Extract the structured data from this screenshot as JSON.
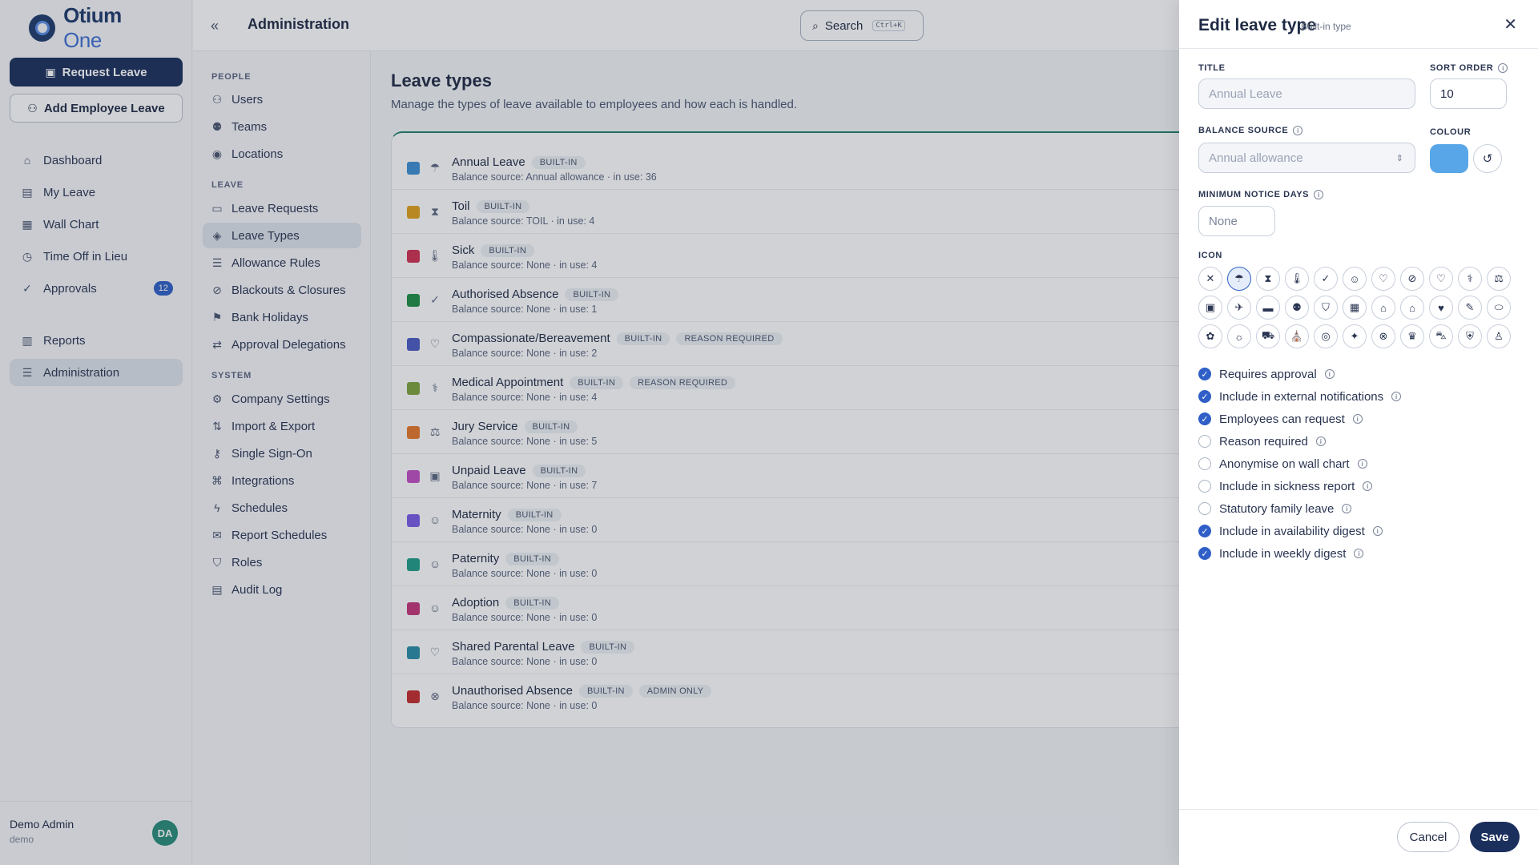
{
  "app": {
    "logo_main": "Otium",
    "logo_accent": "One"
  },
  "sidebar": {
    "request_leave": "Request Leave",
    "add_employee_leave": "Add Employee Leave",
    "items": [
      {
        "label": "Dashboard",
        "icon": "home-icon"
      },
      {
        "label": "My Leave",
        "icon": "calendar-icon"
      },
      {
        "label": "Wall Chart",
        "icon": "calendar-grid-icon"
      },
      {
        "label": "Time Off in Lieu",
        "icon": "clock-icon"
      },
      {
        "label": "Approvals",
        "icon": "check-circle-icon",
        "badge": "12"
      },
      {
        "label": "Reports",
        "icon": "report-icon"
      },
      {
        "label": "Administration",
        "icon": "sliders-icon",
        "active": true
      }
    ],
    "user": {
      "name": "Demo Admin",
      "role": "demo",
      "initials": "DA"
    }
  },
  "topbar": {
    "title": "Administration",
    "search_label": "Search",
    "search_shortcut": "Ctrl+K"
  },
  "admin_nav": {
    "people_label": "PEOPLE",
    "people": [
      "Users",
      "Teams",
      "Locations"
    ],
    "leave_label": "LEAVE",
    "leave": [
      "Leave Requests",
      "Leave Types",
      "Allowance Rules",
      "Blackouts & Closures",
      "Bank Holidays",
      "Approval Delegations"
    ],
    "system_label": "SYSTEM",
    "system": [
      "Company Settings",
      "Import & Export",
      "Single Sign-On",
      "Integrations",
      "Schedules",
      "Report Schedules",
      "Roles",
      "Audit Log"
    ]
  },
  "main": {
    "title": "Leave types",
    "subtitle": "Manage the types of leave available to employees and how each is handled.",
    "rows": [
      {
        "title": "Annual Leave",
        "badges": [
          "BUILT-IN"
        ],
        "sub": "Balance source: Annual allowance · in use: 36",
        "color": "#3d8fd4"
      },
      {
        "title": "Toil",
        "badges": [
          "BUILT-IN"
        ],
        "sub": "Balance source: TOIL · in use: 4",
        "color": "#e0a21a"
      },
      {
        "title": "Sick",
        "badges": [
          "BUILT-IN"
        ],
        "sub": "Balance source: None · in use: 4",
        "color": "#d12f52"
      },
      {
        "title": "Authorised Absence",
        "badges": [
          "BUILT-IN"
        ],
        "sub": "Balance source: None · in use: 1",
        "color": "#1f8f45"
      },
      {
        "title": "Compassionate/Bereavement",
        "badges": [
          "BUILT-IN",
          "REASON REQUIRED"
        ],
        "sub": "Balance source: None · in use: 2",
        "color": "#4b5bc4"
      },
      {
        "title": "Medical Appointment",
        "badges": [
          "BUILT-IN",
          "REASON REQUIRED"
        ],
        "sub": "Balance source: None · in use: 4",
        "color": "#7ea33a"
      },
      {
        "title": "Jury Service",
        "badges": [
          "BUILT-IN"
        ],
        "sub": "Balance source: None · in use: 5",
        "color": "#e8772a"
      },
      {
        "title": "Unpaid Leave",
        "badges": [
          "BUILT-IN"
        ],
        "sub": "Balance source: None · in use: 7",
        "color": "#c24fc2"
      },
      {
        "title": "Maternity",
        "badges": [
          "BUILT-IN"
        ],
        "sub": "Balance source: None · in use: 0",
        "color": "#7a5be8"
      },
      {
        "title": "Paternity",
        "badges": [
          "BUILT-IN"
        ],
        "sub": "Balance source: None · in use: 0",
        "color": "#1f9e8a"
      },
      {
        "title": "Adoption",
        "badges": [
          "BUILT-IN"
        ],
        "sub": "Balance source: None · in use: 0",
        "color": "#c4347a"
      },
      {
        "title": "Shared Parental Leave",
        "badges": [
          "BUILT-IN"
        ],
        "sub": "Balance source: None · in use: 0",
        "color": "#2a8ca8"
      },
      {
        "title": "Unauthorised Absence",
        "badges": [
          "BUILT-IN",
          "ADMIN ONLY"
        ],
        "sub": "Balance source: None · in use: 0",
        "color": "#c42b2b"
      }
    ]
  },
  "panel": {
    "title": "Edit leave type",
    "tag": "Built-in type",
    "title_label": "TITLE",
    "title_placeholder": "Annual Leave",
    "sort_label": "SORT ORDER",
    "sort_value": "10",
    "balance_label": "BALANCE SOURCE",
    "balance_value": "Annual allowance",
    "colour_label": "COLOUR",
    "colour_value": "#58a6e8",
    "notice_label": "MINIMUM NOTICE DAYS",
    "notice_placeholder": "None",
    "icon_label": "ICON",
    "options": [
      {
        "label": "Requires approval",
        "checked": true
      },
      {
        "label": "Include in external notifications",
        "checked": true
      },
      {
        "label": "Employees can request",
        "checked": true
      },
      {
        "label": "Reason required",
        "checked": false
      },
      {
        "label": "Anonymise on wall chart",
        "checked": false
      },
      {
        "label": "Include in sickness report",
        "checked": false
      },
      {
        "label": "Statutory family leave",
        "checked": false
      },
      {
        "label": "Include in availability digest",
        "checked": true
      },
      {
        "label": "Include in weekly digest",
        "checked": true
      }
    ],
    "cancel": "Cancel",
    "save": "Save"
  }
}
